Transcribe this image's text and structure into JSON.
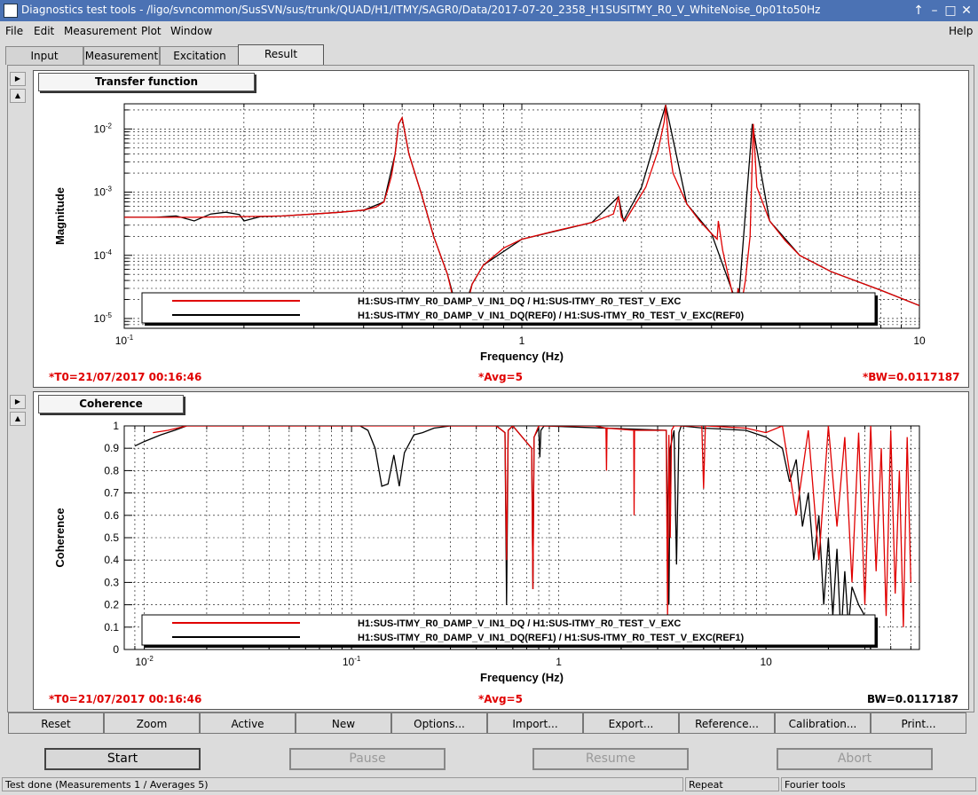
{
  "window": {
    "title": "Diagnostics test tools - /ligo/svncommon/SusSVN/sus/trunk/QUAD/H1/ITMY/SAGR0/Data/2017-07-20_2358_H1SUSITMY_R0_V_WhiteNoise_0p01to50Hz",
    "buttons": [
      "↑",
      "–",
      "□",
      "✕"
    ]
  },
  "menu": {
    "items": [
      "File",
      "Edit",
      "Measurement",
      "Plot",
      "Window"
    ],
    "help": "Help"
  },
  "tabs": [
    "Input",
    "Measurement",
    "Excitation",
    "Result"
  ],
  "active_tab": "Result",
  "panels": [
    {
      "label": "Transfer function",
      "stat_t0": "*T0=21/07/2017 00:16:46",
      "stat_avg": "*Avg=5",
      "stat_bw": "*BW=0.0117187"
    },
    {
      "label": "Coherence",
      "stat_t0": "*T0=21/07/2017 00:16:46",
      "stat_avg": "*Avg=5",
      "stat_bw": "BW=0.0117187"
    }
  ],
  "chart_data": [
    {
      "type": "line",
      "xlabel": "Frequency (Hz)",
      "ylabel": "Magnitude",
      "x_scale": "log",
      "y_scale": "log",
      "xlim": [
        0.1,
        10
      ],
      "ylim": [
        7e-06,
        0.025
      ],
      "x_ticks": [
        {
          "v": 0.1,
          "b": "10",
          "e": "-1"
        },
        {
          "v": 1,
          "b": "1",
          "e": ""
        },
        {
          "v": 10,
          "b": "10",
          "e": ""
        }
      ],
      "y_ticks": [
        {
          "v": 1e-05,
          "b": "10",
          "e": "-5"
        },
        {
          "v": 0.0001,
          "b": "10",
          "e": "-4"
        },
        {
          "v": 0.001,
          "b": "10",
          "e": "-3"
        },
        {
          "v": 0.01,
          "b": "10",
          "e": "-2"
        }
      ],
      "legend": "bottom",
      "series": [
        {
          "name": "H1:SUS-ITMY_R0_DAMP_V_IN1_DQ / H1:SUS-ITMY_R0_TEST_V_EXC",
          "color": "#e00000",
          "x": [
            0.1,
            0.15,
            0.2,
            0.25,
            0.3,
            0.35,
            0.4,
            0.43,
            0.45,
            0.46,
            0.47,
            0.48,
            0.49,
            0.5,
            0.52,
            0.56,
            0.6,
            0.65,
            0.68,
            0.7,
            0.72,
            0.75,
            0.8,
            0.9,
            1.0,
            1.2,
            1.5,
            1.7,
            1.75,
            1.78,
            1.82,
            1.9,
            2.05,
            2.2,
            2.28,
            2.3,
            2.34,
            2.4,
            2.6,
            2.8,
            3.0,
            3.1,
            3.12,
            3.2,
            3.3,
            3.45,
            3.5,
            3.55,
            3.65,
            3.75,
            3.78,
            3.82,
            3.9,
            4.2,
            4.6,
            5.0,
            6.0,
            8.0,
            10
          ],
          "y": [
            0.0004,
            0.0004,
            0.00041,
            0.00042,
            0.00045,
            0.00048,
            0.00052,
            0.00058,
            0.0007,
            0.0011,
            0.0018,
            0.004,
            0.012,
            0.015,
            0.004,
            0.0009,
            0.0002,
            5e-05,
            1.5e-05,
            9e-06,
            1.2e-05,
            3.5e-05,
            7e-05,
            0.00013,
            0.00018,
            0.00024,
            0.00033,
            0.00045,
            0.00085,
            0.0004,
            0.00035,
            0.00055,
            0.0012,
            0.0045,
            0.013,
            0.024,
            0.006,
            0.002,
            0.00065,
            0.00035,
            0.00022,
            0.00018,
            0.00035,
            0.00012,
            5e-05,
            1.5e-05,
            3e-05,
            1.4e-05,
            4e-05,
            0.0002,
            0.0011,
            0.012,
            0.0012,
            0.00035,
            0.00017,
            0.0001,
            5.5e-05,
            2.8e-05,
            1.6e-05
          ]
        },
        {
          "name": "H1:SUS-ITMY_R0_DAMP_V_IN1_DQ(REF0) / H1:SUS-ITMY_R0_TEST_V_EXC(REF0)",
          "color": "#000000",
          "x": [
            0.1,
            0.12,
            0.135,
            0.15,
            0.165,
            0.18,
            0.195,
            0.2,
            0.22,
            0.25,
            0.3,
            0.35,
            0.4,
            0.45,
            0.48,
            0.49,
            0.5,
            0.52,
            0.56,
            0.6,
            0.65,
            0.7,
            0.75,
            0.8,
            1.0,
            1.5,
            1.75,
            1.8,
            2.0,
            2.3,
            2.6,
            3.0,
            3.5,
            3.8,
            4.2,
            5.0,
            6.0,
            8.0,
            10
          ],
          "y": [
            0.0004,
            0.0004,
            0.00042,
            0.00035,
            0.00045,
            0.00048,
            0.00044,
            0.00035,
            0.00041,
            0.00042,
            0.00045,
            0.00048,
            0.00052,
            0.0007,
            0.004,
            0.012,
            0.015,
            0.004,
            0.0009,
            0.0002,
            5e-05,
            9e-06,
            3.5e-05,
            7e-05,
            0.00018,
            0.00033,
            0.00085,
            0.00035,
            0.0012,
            0.024,
            0.00065,
            0.00022,
            1.5e-05,
            0.012,
            0.00035,
            0.0001,
            5.5e-05,
            2.8e-05,
            1.6e-05
          ]
        }
      ]
    },
    {
      "type": "line",
      "xlabel": "Frequency (Hz)",
      "ylabel": "Coherence",
      "x_scale": "log",
      "y_scale": "linear",
      "xlim": [
        0.008,
        55
      ],
      "ylim": [
        0,
        1
      ],
      "x_ticks": [
        {
          "v": 0.01,
          "b": "10",
          "e": "-2"
        },
        {
          "v": 0.1,
          "b": "10",
          "e": "-1"
        },
        {
          "v": 1,
          "b": "1",
          "e": ""
        },
        {
          "v": 10,
          "b": "10",
          "e": ""
        }
      ],
      "y_ticks": [
        {
          "v": 0,
          "b": "0",
          "e": ""
        },
        {
          "v": 0.1,
          "b": "0.1",
          "e": ""
        },
        {
          "v": 0.2,
          "b": "0.2",
          "e": ""
        },
        {
          "v": 0.3,
          "b": "0.3",
          "e": ""
        },
        {
          "v": 0.4,
          "b": "0.4",
          "e": ""
        },
        {
          "v": 0.5,
          "b": "0.5",
          "e": ""
        },
        {
          "v": 0.6,
          "b": "0.6",
          "e": ""
        },
        {
          "v": 0.7,
          "b": "0.7",
          "e": ""
        },
        {
          "v": 0.8,
          "b": "0.8",
          "e": ""
        },
        {
          "v": 0.9,
          "b": "0.9",
          "e": ""
        },
        {
          "v": 1,
          "b": "1",
          "e": ""
        }
      ],
      "legend": "bottom",
      "series": [
        {
          "name": "H1:SUS-ITMY_R0_DAMP_V_IN1_DQ / H1:SUS-ITMY_R0_TEST_V_EXC",
          "color": "#e00000",
          "x": [
            0.011,
            0.013,
            0.016,
            0.02,
            0.5,
            0.55,
            0.56,
            0.57,
            0.6,
            0.74,
            0.75,
            0.76,
            0.8,
            1.5,
            1.69,
            1.7,
            1.71,
            2.3,
            2.31,
            2.32,
            3.3,
            3.35,
            3.4,
            3.45,
            3.5,
            3.6,
            4.9,
            5.0,
            5.1,
            8,
            10,
            12,
            14,
            16,
            18,
            20,
            22,
            24,
            26,
            28,
            30,
            32,
            34,
            36,
            38,
            40,
            42,
            44,
            46,
            48,
            50
          ],
          "y": [
            0.97,
            0.98,
            1.0,
            1.0,
            1.0,
            0.97,
            0.4,
            0.98,
            1.0,
            0.9,
            0.27,
            0.95,
            1.0,
            1.0,
            0.99,
            0.8,
            0.99,
            0.98,
            0.6,
            0.98,
            0.98,
            0.15,
            0.96,
            0.5,
            0.98,
            1.0,
            1.0,
            0.72,
            1.0,
            0.99,
            0.97,
            1.0,
            0.6,
            0.98,
            0.4,
            1.0,
            0.55,
            0.95,
            0.3,
            0.97,
            0.2,
            1.0,
            0.35,
            0.9,
            0.15,
            0.98,
            0.25,
            0.8,
            0.1,
            0.95,
            0.3
          ]
        },
        {
          "name": "H1:SUS-ITMY_R0_DAMP_V_IN1_DQ(REF1) / H1:SUS-ITMY_R0_TEST_V_EXC(REF1)",
          "color": "#000000",
          "x": [
            0.009,
            0.01,
            0.012,
            0.014,
            0.016,
            0.11,
            0.12,
            0.13,
            0.14,
            0.15,
            0.16,
            0.17,
            0.18,
            0.2,
            0.22,
            0.25,
            0.3,
            0.5,
            0.55,
            0.56,
            0.57,
            0.6,
            0.74,
            0.75,
            0.76,
            0.8,
            0.81,
            0.82,
            0.85,
            3.3,
            3.4,
            3.45,
            3.6,
            3.7,
            3.8,
            3.9,
            5,
            8,
            10,
            12,
            13,
            14,
            15,
            16,
            17,
            18,
            19,
            20,
            21,
            22,
            23,
            24,
            25,
            26,
            28,
            30,
            32
          ],
          "y": [
            0.91,
            0.93,
            0.96,
            0.98,
            1.0,
            1.0,
            0.98,
            0.9,
            0.73,
            0.74,
            0.87,
            0.73,
            0.88,
            0.96,
            0.97,
            0.99,
            1.0,
            1.0,
            0.97,
            0.2,
            0.98,
            1.0,
            0.9,
            0.27,
            0.95,
            0.99,
            0.86,
            0.98,
            1.0,
            0.98,
            0.2,
            0.9,
            0.98,
            0.38,
            0.97,
            1.0,
            0.99,
            0.98,
            0.95,
            0.9,
            0.75,
            0.85,
            0.55,
            0.7,
            0.4,
            0.6,
            0.2,
            0.5,
            0.15,
            0.45,
            0.05,
            0.35,
            0.1,
            0.28,
            0.2,
            0.15,
            0.0
          ]
        }
      ]
    }
  ],
  "bottom_buttons": [
    "Reset",
    "Zoom",
    "Active",
    "New",
    "Options...",
    "Import...",
    "Export...",
    "Reference...",
    "Calibration...",
    "Print..."
  ],
  "main_buttons": [
    "Start",
    "Pause",
    "Resume",
    "Abort"
  ],
  "status": [
    "Test done (Measurements 1 / Averages 5)",
    "Repeat",
    "Fourier tools"
  ]
}
